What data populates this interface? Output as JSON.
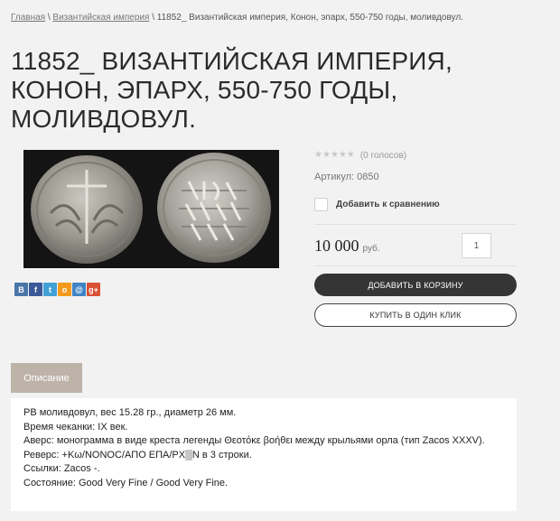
{
  "breadcrumb": {
    "home": "Главная",
    "separator": "\\",
    "category": "Византийская империя",
    "current": "11852_ Византийская империя, Конон, эпарх, 550-750 годы, моливдовул."
  },
  "product": {
    "title": "11852_ ВИЗАНТИЙСКАЯ ИМПЕРИЯ, КОНОН, ЭПАРХ, 550-750 ГОДЫ, МОЛИВДОВУЛ.",
    "rating": {
      "stars": 0,
      "max": 5,
      "votes_label": "(0 голосов)"
    },
    "sku_label": "Артикул:",
    "sku_value": "0850",
    "compare_label": "Добавить к сравнению",
    "price": "10 000",
    "currency": "руб.",
    "quantity": "1",
    "add_to_cart": "ДОБАВИТЬ В КОРЗИНУ",
    "buy_one_click": "КУПИТЬ В ОДИН КЛИК"
  },
  "social": [
    {
      "icon": "vk-icon",
      "glyph": "B",
      "color": "#4a76a8"
    },
    {
      "icon": "facebook-icon",
      "glyph": "f",
      "color": "#3b5998"
    },
    {
      "icon": "twitter-icon",
      "glyph": "t",
      "color": "#41a1d6"
    },
    {
      "icon": "odnoklassniki-icon",
      "glyph": "o",
      "color": "#f59a1b"
    },
    {
      "icon": "mailru-icon",
      "glyph": "@",
      "color": "#3f84c6"
    },
    {
      "icon": "googleplus-icon",
      "glyph": "g+",
      "color": "#d95032"
    }
  ],
  "tabs": [
    {
      "label": "Описание",
      "active": true
    }
  ],
  "description": [
    "PB моливдовул, вес 15.28 гр., диаметр 26 мм.",
    "Время чеканки: IX век.",
    "Аверс: монограмма в виде креста легенды Θεοτόκε βοήθει между крыльями орла (тип Zacos XXXV).",
    "Реверс: +Kω/NONOC/AПO EПA/PX▒N в 3 строки.",
    "Ссылки: Zacos -.",
    "Состояние: Good Very Fine / Good Very Fine."
  ],
  "colors": {
    "accent_dark": "#353535",
    "tab_bg": "#bdb3a8",
    "page_bg": "#f2f2f2"
  }
}
